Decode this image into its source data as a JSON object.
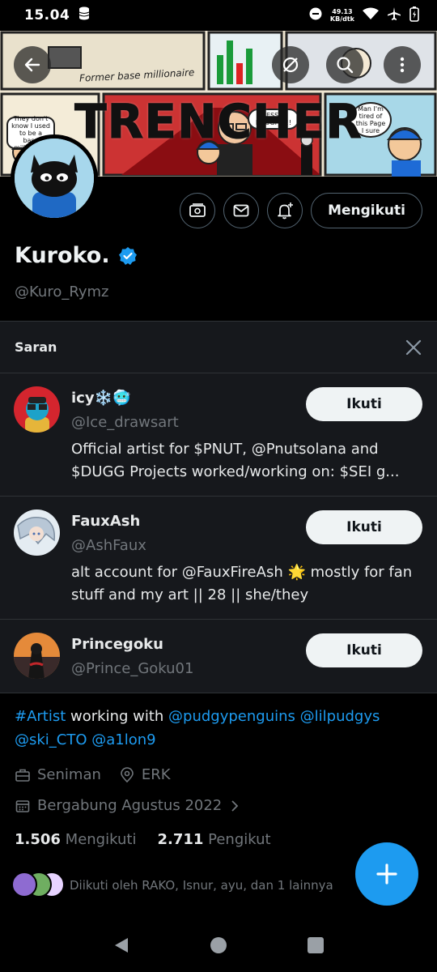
{
  "status_bar": {
    "time": "15.04",
    "net_speed_value": "49.13",
    "net_speed_unit": "KB/dtk"
  },
  "header": {
    "banner_title": "TRENCHER",
    "banner_caption": "Former base millionaire",
    "bubble_left": "They don't know I used to be a base millionaire",
    "bubble_center": "JESSE BOUGHT!!!",
    "bubble_right": "Man I'm tired of this Page I sure"
  },
  "profile": {
    "display_name": "Kuroko.",
    "handle": "@Kuro_Rymz",
    "follow_state_label": "Mengikuti"
  },
  "suggestions": {
    "title": "Saran",
    "items": [
      {
        "name": "icy❄️🥶",
        "handle": "@Ice_drawsart",
        "bio": "Official artist for $PNUT, @Pnutsolana and $DUGG Projects worked/working on: $SEI g...",
        "button": "Ikuti"
      },
      {
        "name": "FauxAsh",
        "handle": "@AshFaux",
        "bio": "alt account for @FauxFireAsh 🌟 mostly for fan stuff and my art || 28 || she/they",
        "button": "Ikuti"
      },
      {
        "name": "Princegoku",
        "handle": "@Prince_Goku01",
        "bio": "",
        "button": "Ikuti"
      }
    ]
  },
  "bio": {
    "hashtag": "#Artist",
    "text1": " working with ",
    "mention1": "@pudgypenguins",
    "mention2": "@lilpudgys",
    "mention3": "@ski_CTO",
    "mention4": "@a1lon9"
  },
  "meta": {
    "profession": "Seniman",
    "location": "ERK",
    "joined": "Bergabung Agustus 2022"
  },
  "stats": {
    "following_count": "1.506",
    "following_label": "Mengikuti",
    "followers_count": "2.711",
    "followers_label": "Pengikut"
  },
  "followed_by": "Diikuti oleh RAKO, Isnur, ayu, dan 1 lainnya",
  "colors": {
    "accent": "#1d9bf0",
    "background": "#000000",
    "panel": "#16181c",
    "muted": "#71767b"
  }
}
